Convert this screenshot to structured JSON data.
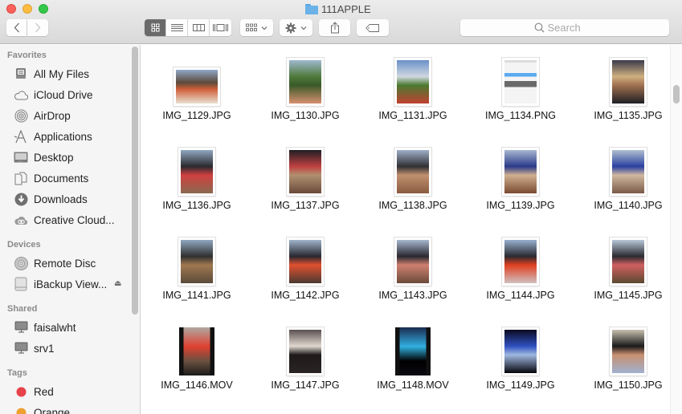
{
  "window": {
    "title": "111APPLE",
    "traffic_lights": [
      "close",
      "minimize",
      "zoom"
    ]
  },
  "toolbar": {
    "back_icon": "chevron-left-icon",
    "forward_icon": "chevron-right-icon",
    "view_modes": [
      {
        "name": "icon-view",
        "icon": "grid-icon",
        "active": true
      },
      {
        "name": "list-view",
        "icon": "list-icon",
        "active": false
      },
      {
        "name": "column-view",
        "icon": "columns-icon",
        "active": false
      },
      {
        "name": "cover-flow-view",
        "icon": "coverflow-icon",
        "active": false
      }
    ],
    "arrange_icon": "arrange-grid-icon",
    "action_icon": "gear-icon",
    "share_icon": "share-icon",
    "tags_icon": "tag-icon",
    "search": {
      "placeholder": "Search",
      "value": ""
    }
  },
  "sidebar": {
    "sections": [
      {
        "title": "Favorites",
        "items": [
          {
            "label": "All My Files",
            "icon": "all-files-icon"
          },
          {
            "label": "iCloud Drive",
            "icon": "cloud-icon"
          },
          {
            "label": "AirDrop",
            "icon": "airdrop-icon"
          },
          {
            "label": "Applications",
            "icon": "applications-icon"
          },
          {
            "label": "Desktop",
            "icon": "desktop-icon"
          },
          {
            "label": "Documents",
            "icon": "documents-icon"
          },
          {
            "label": "Downloads",
            "icon": "downloads-icon"
          },
          {
            "label": "Creative Cloud...",
            "icon": "creative-cloud-icon"
          }
        ]
      },
      {
        "title": "Devices",
        "items": [
          {
            "label": "Remote Disc",
            "icon": "disc-icon"
          },
          {
            "label": "iBackup View...",
            "icon": "drive-icon",
            "eject": "⏏"
          }
        ]
      },
      {
        "title": "Shared",
        "items": [
          {
            "label": "faisalwht",
            "icon": "computer-icon"
          },
          {
            "label": "srv1",
            "icon": "computer-icon"
          }
        ]
      },
      {
        "title": "Tags",
        "items": [
          {
            "label": "Red",
            "icon": "tag-dot-icon",
            "color": "#e8424a"
          },
          {
            "label": "Orange",
            "icon": "tag-dot-icon",
            "color": "#f0a030"
          }
        ]
      }
    ]
  },
  "files": [
    {
      "name": "IMG_1129.JPG",
      "orientation": "landscape",
      "palette": [
        "#8fa8c8",
        "#5c4a3a",
        "#d0603a",
        "#e8e0d0"
      ]
    },
    {
      "name": "IMG_1130.JPG",
      "orientation": "portrait",
      "palette": [
        "#a0b8d0",
        "#4e7a3a",
        "#3a5a2a",
        "#d89070"
      ]
    },
    {
      "name": "IMG_1131.JPG",
      "orientation": "portrait",
      "palette": [
        "#6a90c8",
        "#d0d8e0",
        "#4a7a30",
        "#c04030"
      ]
    },
    {
      "name": "IMG_1134.PNG",
      "orientation": "portrait",
      "palette": [
        "#f4f4f4",
        "#5aaaf0",
        "#e8e8e8",
        "#6a6a6a"
      ]
    },
    {
      "name": "IMG_1135.JPG",
      "orientation": "portrait",
      "palette": [
        "#3a3a4a",
        "#d0b080",
        "#a07050",
        "#1e1e24"
      ]
    },
    {
      "name": "IMG_1136.JPG",
      "orientation": "portrait",
      "palette": [
        "#90a8c0",
        "#2a2a30",
        "#d04040",
        "#8a6a50"
      ]
    },
    {
      "name": "IMG_1137.JPG",
      "orientation": "portrait",
      "palette": [
        "#1e1e24",
        "#c04040",
        "#b09070",
        "#6a4a3a"
      ]
    },
    {
      "name": "IMG_1138.JPG",
      "orientation": "portrait",
      "palette": [
        "#a0b0c8",
        "#303034",
        "#c09070",
        "#8a5a40"
      ]
    },
    {
      "name": "IMG_1139.JPG",
      "orientation": "portrait",
      "palette": [
        "#a8b8d0",
        "#2a3a8a",
        "#d0b090",
        "#7a4a30"
      ]
    },
    {
      "name": "IMG_1140.JPG",
      "orientation": "portrait",
      "palette": [
        "#b0c0d0",
        "#2a40a0",
        "#d0b8a0",
        "#7a5a48"
      ]
    },
    {
      "name": "IMG_1141.JPG",
      "orientation": "portrait",
      "palette": [
        "#90a8c0",
        "#303030",
        "#a07850",
        "#5a4a3a"
      ]
    },
    {
      "name": "IMG_1142.JPG",
      "orientation": "portrait",
      "palette": [
        "#a0b4cc",
        "#282830",
        "#e05030",
        "#4a3a30"
      ]
    },
    {
      "name": "IMG_1143.JPG",
      "orientation": "portrait",
      "palette": [
        "#a8b8d0",
        "#282830",
        "#d08070",
        "#6a4a3a"
      ]
    },
    {
      "name": "IMG_1144.JPG",
      "orientation": "portrait",
      "palette": [
        "#98b0d0",
        "#2a2a30",
        "#e04020",
        "#d0c0c0"
      ]
    },
    {
      "name": "IMG_1145.JPG",
      "orientation": "portrait",
      "palette": [
        "#b8c8d8",
        "#2a2a30",
        "#d06060",
        "#5a4a30"
      ]
    },
    {
      "name": "IMG_1146.MOV",
      "orientation": "video",
      "palette": [
        "#1a1a1a",
        "#e04030",
        "#b0a8a0",
        "#6a5040"
      ]
    },
    {
      "name": "IMG_1147.JPG",
      "orientation": "portrait",
      "palette": [
        "#5a5050",
        "#e0d8d0",
        "#1e1a1a",
        "#2a2424"
      ]
    },
    {
      "name": "IMG_1148.MOV",
      "orientation": "video",
      "palette": [
        "#0a0a12",
        "#30b0e0",
        "#1a2a50",
        "#000000"
      ]
    },
    {
      "name": "IMG_1149.JPG",
      "orientation": "portrait",
      "palette": [
        "#0a0a20",
        "#3050c0",
        "#a0b8e0",
        "#05050c"
      ]
    },
    {
      "name": "IMG_1150.JPG",
      "orientation": "portrait",
      "palette": [
        "#c8c0b0",
        "#1a1a1a",
        "#c89070",
        "#a0b0d0"
      ]
    }
  ]
}
